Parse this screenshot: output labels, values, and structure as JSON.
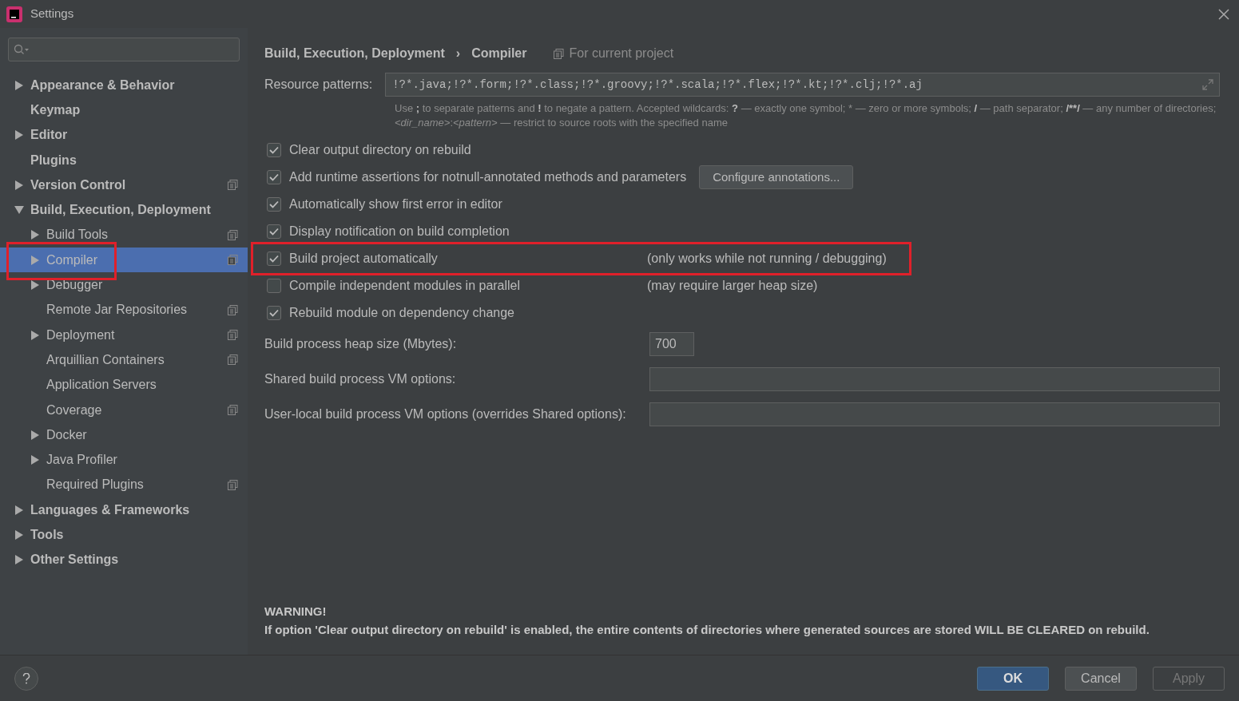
{
  "window": {
    "title": "Settings"
  },
  "sidebar": {
    "items": [
      {
        "label": "Appearance & Behavior",
        "kind": "branch",
        "expanded": false,
        "project_icon": false,
        "selected": false,
        "highlighted": false
      },
      {
        "label": "Keymap",
        "kind": "leaf",
        "project_icon": false,
        "selected": false,
        "highlighted": false
      },
      {
        "label": "Editor",
        "kind": "branch",
        "expanded": false,
        "project_icon": false,
        "selected": false,
        "highlighted": false
      },
      {
        "label": "Plugins",
        "kind": "leaf",
        "project_icon": false,
        "selected": false,
        "highlighted": false
      },
      {
        "label": "Version Control",
        "kind": "branch",
        "expanded": false,
        "project_icon": true,
        "selected": false,
        "highlighted": false
      },
      {
        "label": "Build, Execution, Deployment",
        "kind": "branch",
        "expanded": true,
        "project_icon": false,
        "selected": false,
        "highlighted": false,
        "children": [
          {
            "label": "Build Tools",
            "kind": "branch",
            "expanded": false,
            "project_icon": true,
            "selected": false,
            "highlighted": false
          },
          {
            "label": "Compiler",
            "kind": "branch",
            "expanded": false,
            "project_icon": true,
            "selected": true,
            "highlighted": true
          },
          {
            "label": "Debugger",
            "kind": "branch",
            "expanded": false,
            "project_icon": false,
            "selected": false,
            "highlighted": false
          },
          {
            "label": "Remote Jar Repositories",
            "kind": "leaf",
            "project_icon": true,
            "selected": false,
            "highlighted": false
          },
          {
            "label": "Deployment",
            "kind": "branch",
            "expanded": false,
            "project_icon": true,
            "selected": false,
            "highlighted": false
          },
          {
            "label": "Arquillian Containers",
            "kind": "leaf",
            "project_icon": true,
            "selected": false,
            "highlighted": false
          },
          {
            "label": "Application Servers",
            "kind": "leaf",
            "project_icon": false,
            "selected": false,
            "highlighted": false
          },
          {
            "label": "Coverage",
            "kind": "leaf",
            "project_icon": true,
            "selected": false,
            "highlighted": false
          },
          {
            "label": "Docker",
            "kind": "branch",
            "expanded": false,
            "project_icon": false,
            "selected": false,
            "highlighted": false
          },
          {
            "label": "Java Profiler",
            "kind": "branch",
            "expanded": false,
            "project_icon": false,
            "selected": false,
            "highlighted": false
          },
          {
            "label": "Required Plugins",
            "kind": "leaf",
            "project_icon": true,
            "selected": false,
            "highlighted": false
          }
        ]
      },
      {
        "label": "Languages & Frameworks",
        "kind": "branch",
        "expanded": false,
        "project_icon": false,
        "selected": false,
        "highlighted": false
      },
      {
        "label": "Tools",
        "kind": "branch",
        "expanded": false,
        "project_icon": false,
        "selected": false,
        "highlighted": false
      },
      {
        "label": "Other Settings",
        "kind": "branch",
        "expanded": false,
        "project_icon": false,
        "selected": false,
        "highlighted": false
      }
    ]
  },
  "breadcrumb": [
    "Build, Execution, Deployment",
    "›",
    "Compiler"
  ],
  "scope": "For current project",
  "resource_patterns": {
    "label": "Resource patterns:",
    "value": "!?*.java;!?*.form;!?*.class;!?*.groovy;!?*.scala;!?*.flex;!?*.kt;!?*.clj;!?*.aj",
    "help": [
      {
        "text": "Use ",
        "kind": "plain"
      },
      {
        "text": ";",
        "kind": "bold"
      },
      {
        "text": " to separate patterns and ",
        "kind": "plain"
      },
      {
        "text": "!",
        "kind": "bold"
      },
      {
        "text": " to negate a pattern. Accepted wildcards: ",
        "kind": "plain"
      },
      {
        "text": "?",
        "kind": "bold"
      },
      {
        "text": " — exactly one symbol; * — zero or more symbols; ",
        "kind": "plain"
      },
      {
        "text": "/",
        "kind": "bold"
      },
      {
        "text": " — path separator; ",
        "kind": "plain"
      },
      {
        "text": "/**/",
        "kind": "bold"
      },
      {
        "text": " — any number of directories; ",
        "kind": "plain"
      },
      {
        "text": "<dir_name>",
        "kind": "italic"
      },
      {
        "text": ":",
        "kind": "plain"
      },
      {
        "text": "<pattern>",
        "kind": "italic"
      },
      {
        "text": " — restrict to source roots with the specified name",
        "kind": "plain"
      }
    ]
  },
  "options": [
    {
      "label": "Clear output directory on rebuild",
      "checked": true,
      "highlighted": false
    },
    {
      "label": "Add runtime assertions for notnull-annotated methods and parameters",
      "checked": true,
      "highlighted": false,
      "button": "Configure annotations..."
    },
    {
      "label": "Automatically show first error in editor",
      "checked": true,
      "highlighted": false
    },
    {
      "label": "Display notification on build completion",
      "checked": true,
      "highlighted": false
    },
    {
      "label": "Build project automatically",
      "checked": true,
      "highlighted": true,
      "note": "(only works while not running / debugging)"
    },
    {
      "label": "Compile independent modules in parallel",
      "checked": false,
      "highlighted": false,
      "note": "(may require larger heap size)"
    },
    {
      "label": "Rebuild module on dependency change",
      "checked": true,
      "highlighted": false
    }
  ],
  "fields": [
    {
      "label": "Build process heap size (Mbytes):",
      "value": "700",
      "kind": "short"
    },
    {
      "label": "Shared build process VM options:",
      "kind": "wide"
    },
    {
      "label": "User-local build process VM options (overrides Shared options):",
      "kind": "wide"
    }
  ],
  "warning": {
    "title": "WARNING!",
    "text": "If option 'Clear output directory on rebuild' is enabled, the entire contents of directories where generated sources are stored WILL BE CLEARED on rebuild."
  },
  "buttons": [
    {
      "label": "OK",
      "kind": "primary"
    },
    {
      "label": "Cancel",
      "kind": "normal"
    },
    {
      "label": "Apply",
      "kind": "disabled"
    }
  ]
}
